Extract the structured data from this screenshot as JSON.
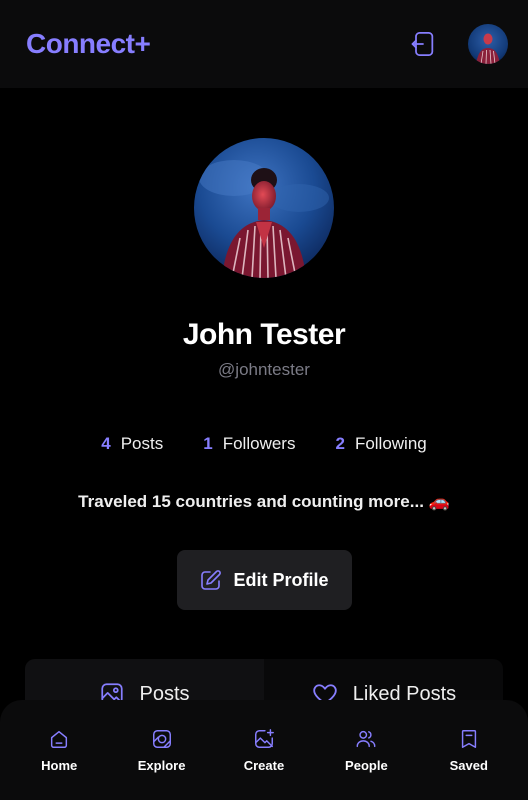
{
  "app": {
    "logo": "Connect+",
    "accent": "#877eff"
  },
  "header": {
    "logout_icon": "logout-icon",
    "avatar_alt": "user-avatar"
  },
  "profile": {
    "name": "John Tester",
    "handle": "@johntester",
    "bio": "Traveled 15 countries and counting more... 🚗",
    "edit_label": "Edit Profile",
    "stats": [
      {
        "value": "4",
        "label": "Posts"
      },
      {
        "value": "1",
        "label": "Followers"
      },
      {
        "value": "2",
        "label": "Following"
      }
    ]
  },
  "tabs": [
    {
      "label": "Posts",
      "icon": "image-icon"
    },
    {
      "label": "Liked Posts",
      "icon": "heart-icon"
    }
  ],
  "bottom_nav": [
    {
      "label": "Home",
      "icon": "home-icon"
    },
    {
      "label": "Explore",
      "icon": "explore-icon"
    },
    {
      "label": "Create",
      "icon": "create-icon"
    },
    {
      "label": "People",
      "icon": "people-icon"
    },
    {
      "label": "Saved",
      "icon": "saved-icon"
    }
  ]
}
